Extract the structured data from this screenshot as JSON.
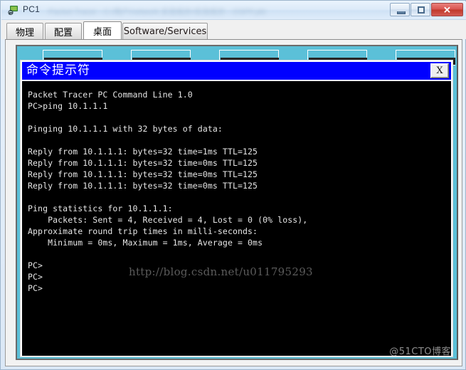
{
  "window": {
    "title": "PC1",
    "icon": "packet-tracer-pc-icon",
    "blurred_subtitle": "Packet Tracer - C:/用户/network 实验拓扑/实验拓扑 - OSPF.pkt",
    "buttons": {
      "minimize": "–",
      "maximize": "□",
      "close": "✕"
    }
  },
  "tabs": [
    {
      "label": "物理",
      "active": false
    },
    {
      "label": "配置",
      "active": false
    },
    {
      "label": "桌面",
      "active": true
    },
    {
      "label": "Software/Services",
      "active": false
    }
  ],
  "desktop": {
    "background_color": "#5bc0d8",
    "icons": [
      {
        "name": "desktop-icon-1"
      },
      {
        "name": "desktop-icon-2"
      },
      {
        "name": "desktop-icon-3"
      },
      {
        "name": "desktop-icon-4"
      },
      {
        "name": "desktop-icon-5"
      }
    ]
  },
  "command_prompt": {
    "title": "命令提示符",
    "titlebar_color": "#0000ff",
    "close_label": "X",
    "terminal": {
      "background_color": "#000000",
      "text_color": "#e6e6e6",
      "content": "Packet Tracer PC Command Line 1.0\nPC>ping 10.1.1.1\n\nPinging 10.1.1.1 with 32 bytes of data:\n\nReply from 10.1.1.1: bytes=32 time=1ms TTL=125\nReply from 10.1.1.1: bytes=32 time=0ms TTL=125\nReply from 10.1.1.1: bytes=32 time=0ms TTL=125\nReply from 10.1.1.1: bytes=32 time=0ms TTL=125\n\nPing statistics for 10.1.1.1:\n    Packets: Sent = 4, Received = 4, Lost = 0 (0% loss),\nApproximate round trip times in milli-seconds:\n    Minimum = 0ms, Maximum = 1ms, Average = 0ms\n\nPC>\nPC>\nPC>"
    }
  },
  "watermarks": {
    "url": "http://blog.csdn.net/u011795293",
    "site": "@51CTO博客"
  }
}
